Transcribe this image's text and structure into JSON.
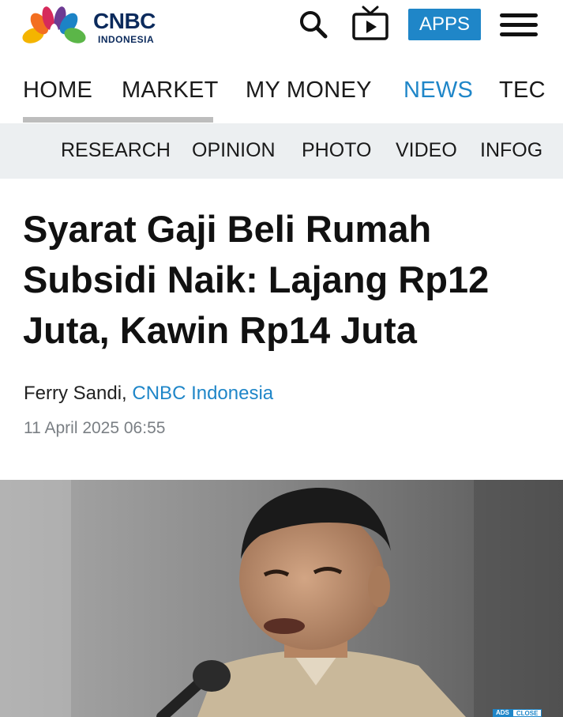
{
  "header": {
    "logo_main": "CNBC",
    "logo_sub": "INDONESIA",
    "apps_label": "APPS",
    "icons": [
      "peacock-logo-icon",
      "search-icon",
      "tv-play-icon",
      "hamburger-menu-icon"
    ]
  },
  "nav": {
    "items": [
      {
        "label": "HOME"
      },
      {
        "label": "MARKET"
      },
      {
        "label": "MY MONEY"
      },
      {
        "label": "NEWS"
      },
      {
        "label": "TEC"
      }
    ],
    "active": "NEWS"
  },
  "subnav": {
    "items": [
      {
        "label": "RESEARCH"
      },
      {
        "label": "OPINION"
      },
      {
        "label": "PHOTO"
      },
      {
        "label": "VIDEO"
      },
      {
        "label": "INFOG"
      }
    ]
  },
  "article": {
    "title": "Syarat Gaji Beli Rumah Subsidi Naik: Lajang Rp12 Juta, Kawin Rp14 Juta",
    "author": "Ferry Sandi,",
    "source": "CNBC Indonesia",
    "date": "11 April 2025 06:55"
  },
  "ad": {
    "ad_label": "ADS",
    "close_label": "CLOSE"
  },
  "colors": {
    "accent": "#1f86c8",
    "subnav_bg": "#eceff1",
    "date_gray": "#7a7f84",
    "logo_navy": "#0b2a5c"
  }
}
